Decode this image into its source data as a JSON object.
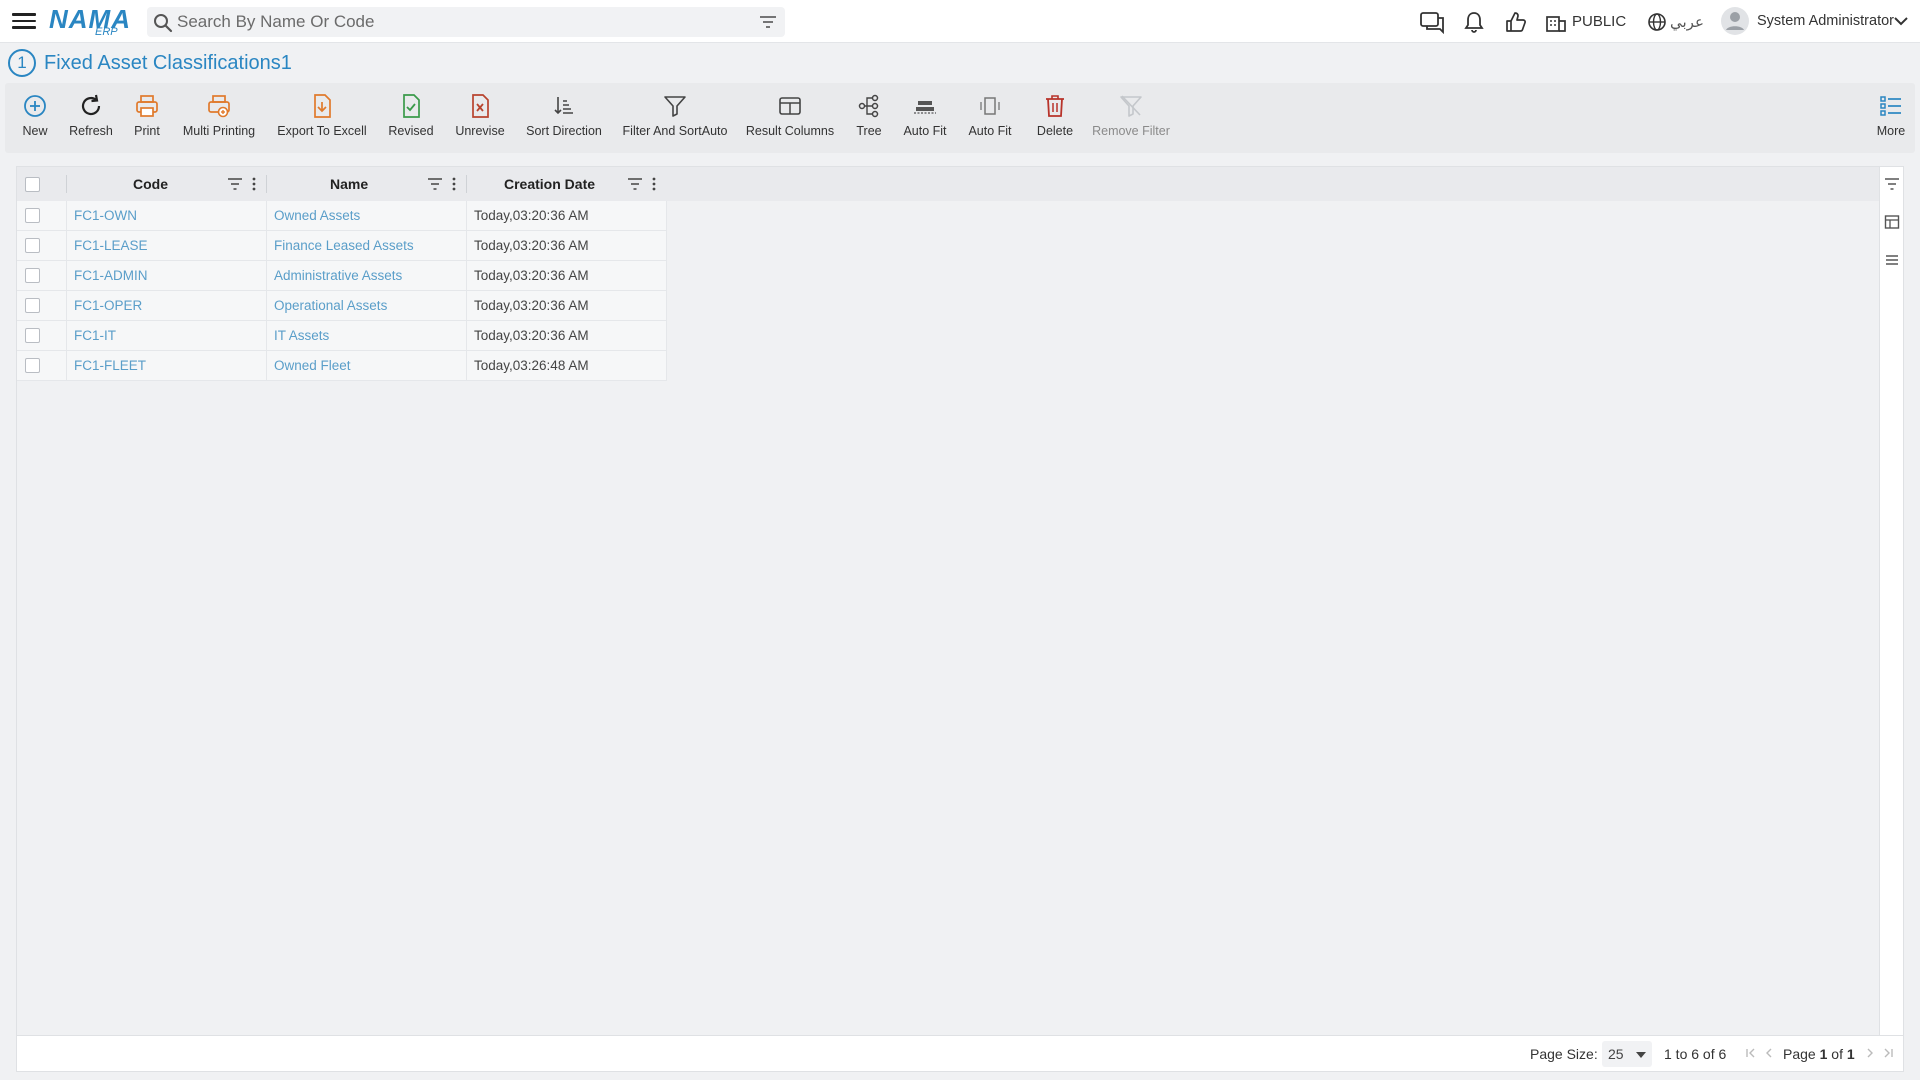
{
  "topbar": {
    "logo_main": "NAMA",
    "logo_sub": "ERP",
    "search_placeholder": "Search By Name Or Code",
    "public_label": "PUBLIC",
    "language_label": "عربي",
    "user_name": "System Administrator"
  },
  "page": {
    "number": "1",
    "title": "Fixed Asset Classifications1"
  },
  "toolbar": {
    "new": "New",
    "refresh": "Refresh",
    "print": "Print",
    "multi_printing": "Multi Printing",
    "export_excel": "Export To Excell",
    "revised": "Revised",
    "unrevise": "Unrevise",
    "sort_direction": "Sort Direction",
    "filter_sort": "Filter And SortAuto",
    "result_columns": "Result Columns",
    "tree": "Tree",
    "auto_fit_1": "Auto Fit",
    "auto_fit_2": "Auto Fit",
    "delete": "Delete",
    "remove_filter": "Remove Filter",
    "more": "More"
  },
  "grid": {
    "columns": {
      "code": "Code",
      "name": "Name",
      "creation_date": "Creation Date"
    },
    "rows": [
      {
        "code": "FC1-OWN",
        "name": "Owned Assets",
        "date": "Today,03:20:36 AM"
      },
      {
        "code": "FC1-LEASE",
        "name": "Finance Leased Assets",
        "date": "Today,03:20:36 AM"
      },
      {
        "code": "FC1-ADMIN",
        "name": "Administrative Assets",
        "date": "Today,03:20:36 AM"
      },
      {
        "code": "FC1-OPER",
        "name": "Operational Assets",
        "date": "Today,03:20:36 AM"
      },
      {
        "code": "FC1-IT",
        "name": "IT Assets",
        "date": "Today,03:20:36 AM"
      },
      {
        "code": "FC1-FLEET",
        "name": "Owned Fleet",
        "date": "Today,03:26:48 AM"
      }
    ]
  },
  "footer": {
    "page_size_label": "Page Size:",
    "page_size_value": "25",
    "range_text": "1 to 6 of 6",
    "page_text_prefix": "Page",
    "page_current": "1",
    "page_of": "of",
    "page_total": "1"
  },
  "colors": {
    "accent": "#2a86c2",
    "link": "#5a9ec9",
    "print_orange": "#e07a2c",
    "revised_green": "#3a9a4a",
    "unrevise_red": "#b8442e",
    "delete_red": "#b8332a"
  }
}
